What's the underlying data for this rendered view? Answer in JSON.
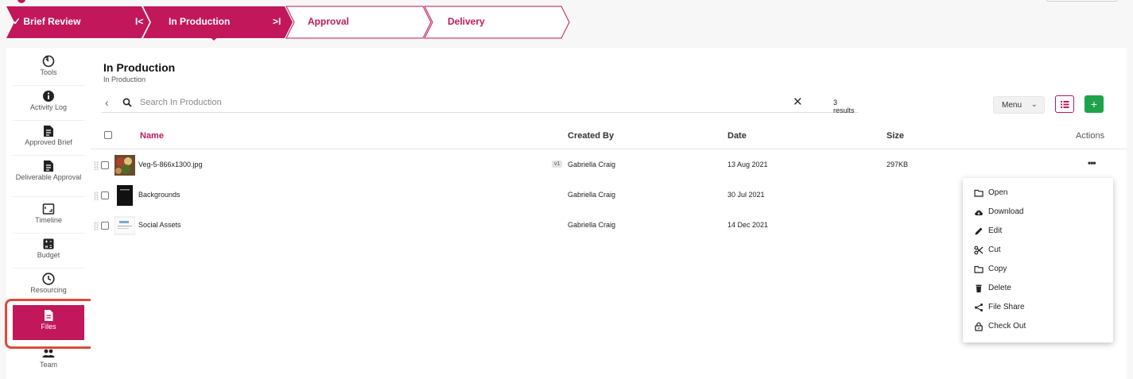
{
  "stepper": {
    "steps": [
      {
        "label": "✓ Brief Review",
        "state": "done"
      },
      {
        "label": "In Production",
        "state": "current"
      },
      {
        "label": "Approval",
        "state": "upcoming"
      },
      {
        "label": "Delivery",
        "state": "upcoming"
      }
    ],
    "prev_control": "I<",
    "next_control": ">I"
  },
  "sidebar": {
    "items": [
      {
        "label": "Tools",
        "icon": "tools-icon"
      },
      {
        "label": "Activity Log",
        "icon": "info-icon"
      },
      {
        "label": "Approved Brief",
        "icon": "brief-icon"
      },
      {
        "label": "Deliverable Approval",
        "icon": "approval-icon"
      },
      {
        "label": "Timeline",
        "icon": "timeline-icon"
      },
      {
        "label": "Budget",
        "icon": "calculator-icon"
      },
      {
        "label": "Resourcing",
        "icon": "clock-icon"
      },
      {
        "label": "Files",
        "icon": "file-icon",
        "active": true
      },
      {
        "label": "Team",
        "icon": "team-icon"
      }
    ]
  },
  "header": {
    "title": "In Production",
    "subtitle": "In Production"
  },
  "search": {
    "placeholder": "Search In Production",
    "value": "",
    "results": "3 results"
  },
  "toolbar": {
    "menu_label": "Menu",
    "add_label": "+"
  },
  "table": {
    "columns": {
      "name": "Name",
      "created_by": "Created By",
      "date": "Date",
      "size": "Size",
      "actions": "Actions"
    },
    "rows": [
      {
        "name": "Veg-5-866x1300.jpg",
        "version": "v1",
        "created_by": "Gabriella Craig",
        "date": "13 Aug 2021",
        "size": "297KB",
        "actions": "•••"
      },
      {
        "name": "Backgrounds",
        "created_by": "Gabriella Craig",
        "date": "30 Jul 2021",
        "size": ""
      },
      {
        "name": "Social Assets",
        "created_by": "Gabriella Craig",
        "date": "14 Dec 2021",
        "size": ""
      }
    ]
  },
  "context_menu": {
    "items": [
      {
        "label": "Open",
        "icon": "folder-icon"
      },
      {
        "label": "Download",
        "icon": "cloud-download-icon"
      },
      {
        "label": "Edit",
        "icon": "pencil-icon"
      },
      {
        "label": "Cut",
        "icon": "scissors-icon"
      },
      {
        "label": "Copy",
        "icon": "copy-icon"
      },
      {
        "label": "Delete",
        "icon": "trash-icon"
      },
      {
        "label": "File Share",
        "icon": "share-icon"
      },
      {
        "label": "Check Out",
        "icon": "lock-icon"
      }
    ]
  },
  "colors": {
    "accent": "#c2185b",
    "add_button": "#1fa34a",
    "annotation": "#e04a3a"
  }
}
